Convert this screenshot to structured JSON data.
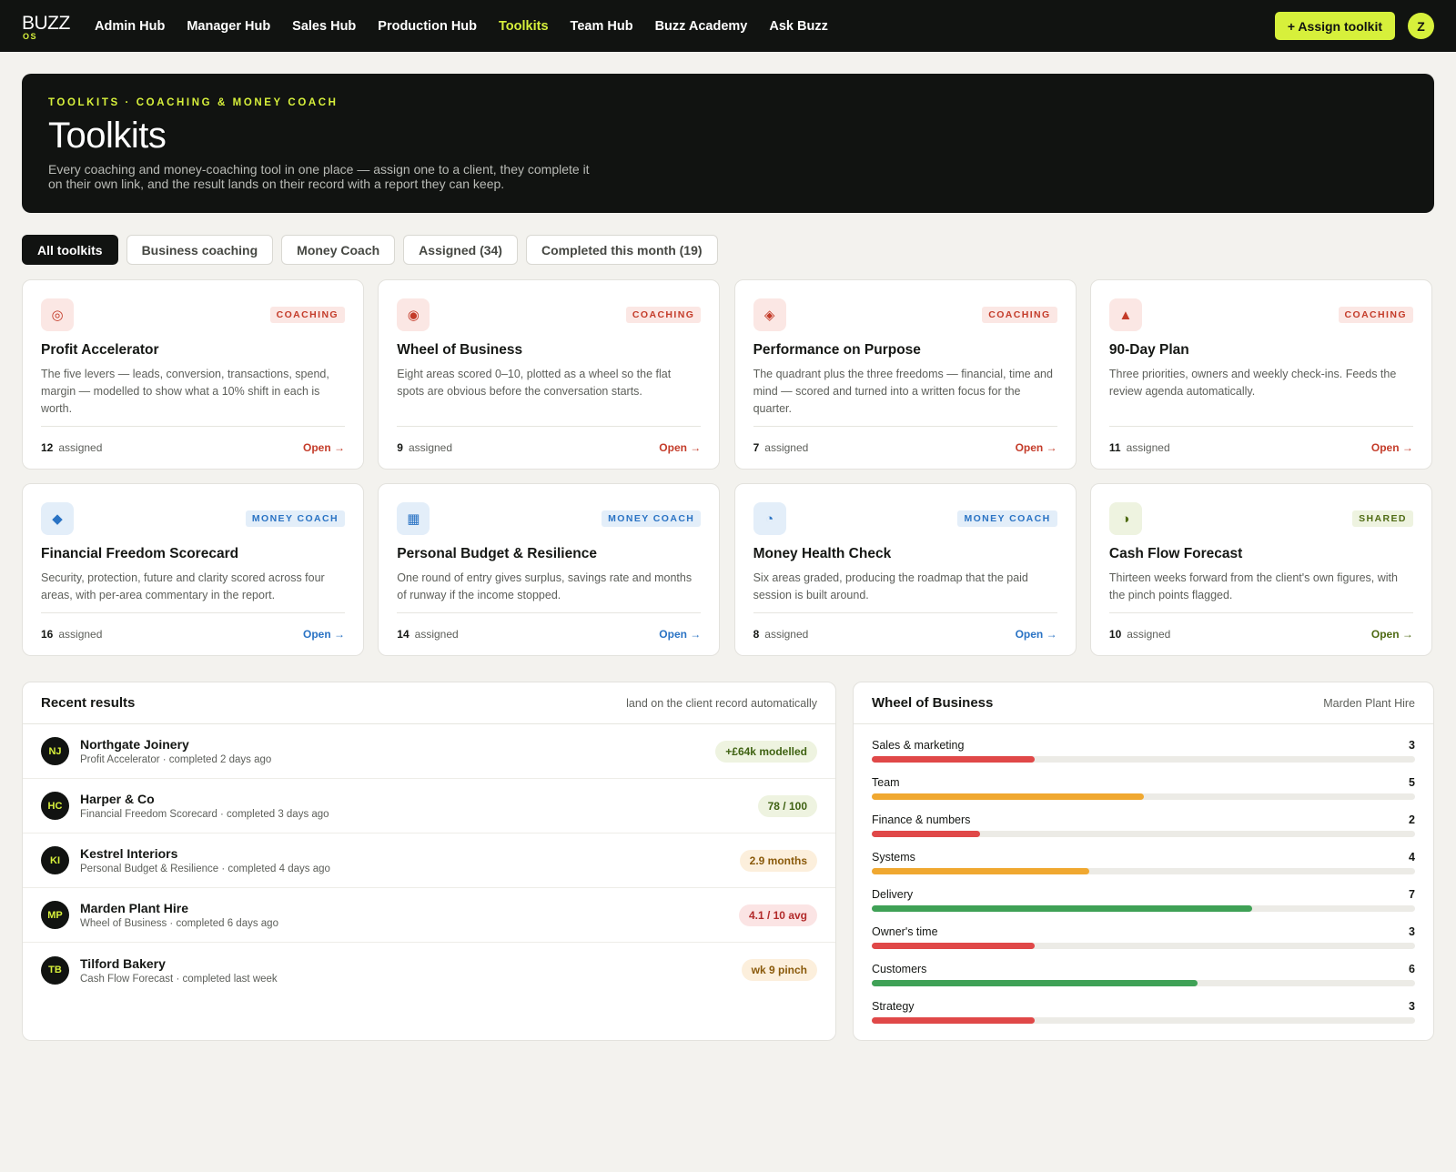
{
  "nav": {
    "logo_word": "BUZZ",
    "logo_sub": "OS",
    "items": [
      "Admin Hub",
      "Manager Hub",
      "Sales Hub",
      "Production Hub",
      "Toolkits",
      "Team Hub",
      "Buzz Academy",
      "Ask Buzz"
    ],
    "active": "Toolkits",
    "assign_button": "+ Assign toolkit",
    "user_initial": "Z"
  },
  "hero": {
    "eyebrow": "TOOLKITS · COACHING & MONEY COACH",
    "title": "Toolkits",
    "description": "Every coaching and money-coaching tool in one place — assign one to a client, they complete it on their own link, and the result lands on their record with a report they can keep."
  },
  "filters": [
    "All toolkits",
    "Business coaching",
    "Money Coach",
    "Assigned (34)",
    "Completed this month (19)"
  ],
  "cards": [
    {
      "icon": "target-icon",
      "glyph": "◎",
      "tag": "COACHING",
      "type": "coach",
      "title": "Profit Accelerator",
      "desc": "The five levers — leads, conversion, transactions, spend, margin — modelled to show what a 10% shift in each is worth.",
      "count": "12",
      "count_label": "assigned",
      "open": "Open →"
    },
    {
      "icon": "wheel-icon",
      "glyph": "◉",
      "tag": "COACHING",
      "type": "coach",
      "title": "Wheel of Business",
      "desc": "Eight areas scored 0–10, plotted as a wheel so the flat spots are obvious before the conversation starts.",
      "count": "9",
      "count_label": "assigned",
      "open": "Open →"
    },
    {
      "icon": "diamond-icon",
      "glyph": "◈",
      "tag": "COACHING",
      "type": "coach",
      "title": "Performance on Purpose",
      "desc": "The quadrant plus the three freedoms — financial, time and mind — scored and turned into a written focus for the quarter.",
      "count": "7",
      "count_label": "assigned",
      "open": "Open →"
    },
    {
      "icon": "triangle-icon",
      "glyph": "▲",
      "tag": "COACHING",
      "type": "coach",
      "title": "90-Day Plan",
      "desc": "Three priorities, owners and weekly check-ins. Feeds the review agenda automatically.",
      "count": "11",
      "count_label": "assigned",
      "open": "Open →"
    },
    {
      "icon": "small-diamond-icon",
      "glyph": "◆",
      "tag": "MONEY COACH",
      "type": "money",
      "title": "Financial Freedom Scorecard",
      "desc": "Security, protection, future and clarity scored across four areas, with per-area commentary in the report.",
      "count": "16",
      "count_label": "assigned",
      "open": "Open →"
    },
    {
      "icon": "square-icon",
      "glyph": "▦",
      "tag": "MONEY COACH",
      "type": "money",
      "title": "Personal Budget & Resilience",
      "desc": "One round of entry gives surplus, savings rate and months of runway if the income stopped.",
      "count": "14",
      "count_label": "assigned",
      "open": "Open →"
    },
    {
      "icon": "pie-icon",
      "glyph": "◔",
      "tag": "MONEY COACH",
      "type": "money",
      "title": "Money Health Check",
      "desc": "Six areas graded, producing the roadmap that the paid session is built around.",
      "count": "8",
      "count_label": "assigned",
      "open": "Open →"
    },
    {
      "icon": "half-circle-icon",
      "glyph": "◑",
      "tag": "SHARED",
      "type": "shared",
      "title": "Cash Flow Forecast",
      "desc": "Thirteen weeks forward from the client's own figures, with the pinch points flagged.",
      "count": "10",
      "count_label": "assigned",
      "open": "Open →"
    }
  ],
  "results": {
    "title": "Recent results",
    "subtitle": "land on the client record automatically",
    "rows": [
      {
        "initials": "NJ",
        "name": "Northgate Joinery",
        "sub": "Profit Accelerator · completed 2 days ago",
        "pill": "+£64k modelled",
        "pill_bg": "#eef3e0",
        "pill_fg": "#3f6212"
      },
      {
        "initials": "HC",
        "name": "Harper & Co",
        "sub": "Financial Freedom Scorecard · completed 3 days ago",
        "pill": "78 / 100",
        "pill_bg": "#eef3e0",
        "pill_fg": "#3f6212"
      },
      {
        "initials": "KI",
        "name": "Kestrel Interiors",
        "sub": "Personal Budget & Resilience · completed 4 days ago",
        "pill": "2.9 months",
        "pill_bg": "#fcefdc",
        "pill_fg": "#8a5a0b"
      },
      {
        "initials": "MP",
        "name": "Marden Plant Hire",
        "sub": "Wheel of Business · completed 6 days ago",
        "pill": "4.1 / 10 avg",
        "pill_bg": "#fbe4e4",
        "pill_fg": "#b22a2a"
      },
      {
        "initials": "TB",
        "name": "Tilford Bakery",
        "sub": "Cash Flow Forecast · completed last week",
        "pill": "wk 9 pinch",
        "pill_bg": "#fcefdc",
        "pill_fg": "#8a5a0b"
      }
    ]
  },
  "wheel": {
    "title": "Wheel of Business",
    "client": "Marden Plant Hire",
    "max": 10,
    "colors": {
      "low": "#e04848",
      "mid": "#f0a830",
      "high": "#3fa156"
    },
    "areas": [
      {
        "label": "Sales & marketing",
        "value": 3,
        "level": "low"
      },
      {
        "label": "Team",
        "value": 5,
        "level": "mid"
      },
      {
        "label": "Finance & numbers",
        "value": 2,
        "level": "low"
      },
      {
        "label": "Systems",
        "value": 4,
        "level": "mid"
      },
      {
        "label": "Delivery",
        "value": 7,
        "level": "high"
      },
      {
        "label": "Owner's time",
        "value": 3,
        "level": "low"
      },
      {
        "label": "Customers",
        "value": 6,
        "level": "high"
      },
      {
        "label": "Strategy",
        "value": 3,
        "level": "low"
      }
    ]
  }
}
